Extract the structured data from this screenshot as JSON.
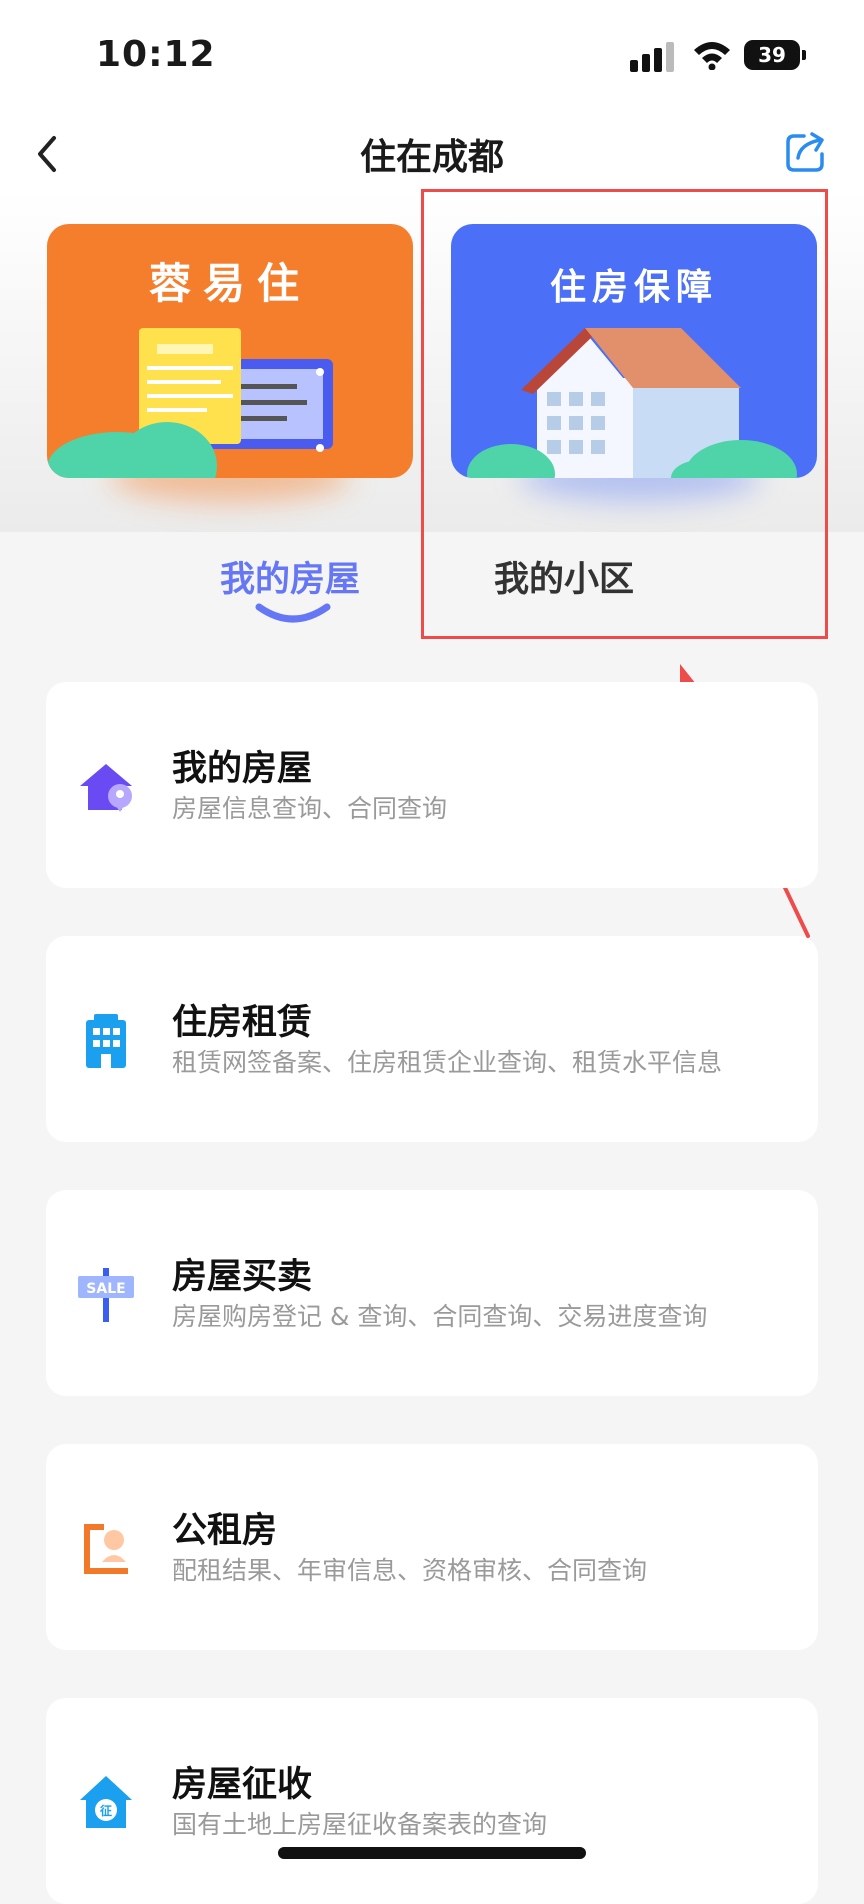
{
  "status_bar": {
    "time": "10:12",
    "battery": "39"
  },
  "nav": {
    "title": "住在成都"
  },
  "banners": [
    {
      "title": "蓉易住",
      "color": "#f57e2c"
    },
    {
      "title": "住房保障",
      "color": "#4b6ff7"
    }
  ],
  "tabs": [
    {
      "label": "我的房屋",
      "active": true
    },
    {
      "label": "我的小区",
      "active": false
    }
  ],
  "cards": [
    {
      "title": "我的房屋",
      "subtitle": "房屋信息查询、合同查询",
      "icon": "house-location-icon"
    },
    {
      "title": "住房租赁",
      "subtitle": "租赁网签备案、住房租赁企业查询、租赁水平信息",
      "icon": "building-icon"
    },
    {
      "title": "房屋买卖",
      "subtitle": "房屋购房登记 & 查询、合同查询、交易进度查询",
      "icon": "sale-sign-icon"
    },
    {
      "title": "公租房",
      "subtitle": "配租结果、年审信息、资格审核、合同查询",
      "icon": "public-housing-icon"
    },
    {
      "title": "房屋征收",
      "subtitle": "国有土地上房屋征收备案表的查询",
      "icon": "expropriation-house-icon"
    }
  ],
  "colors": {
    "accent": "#6577f5",
    "annotation": "#ee4b4b",
    "banner_orange": "#f57e2c",
    "banner_blue": "#4b6ff7"
  }
}
